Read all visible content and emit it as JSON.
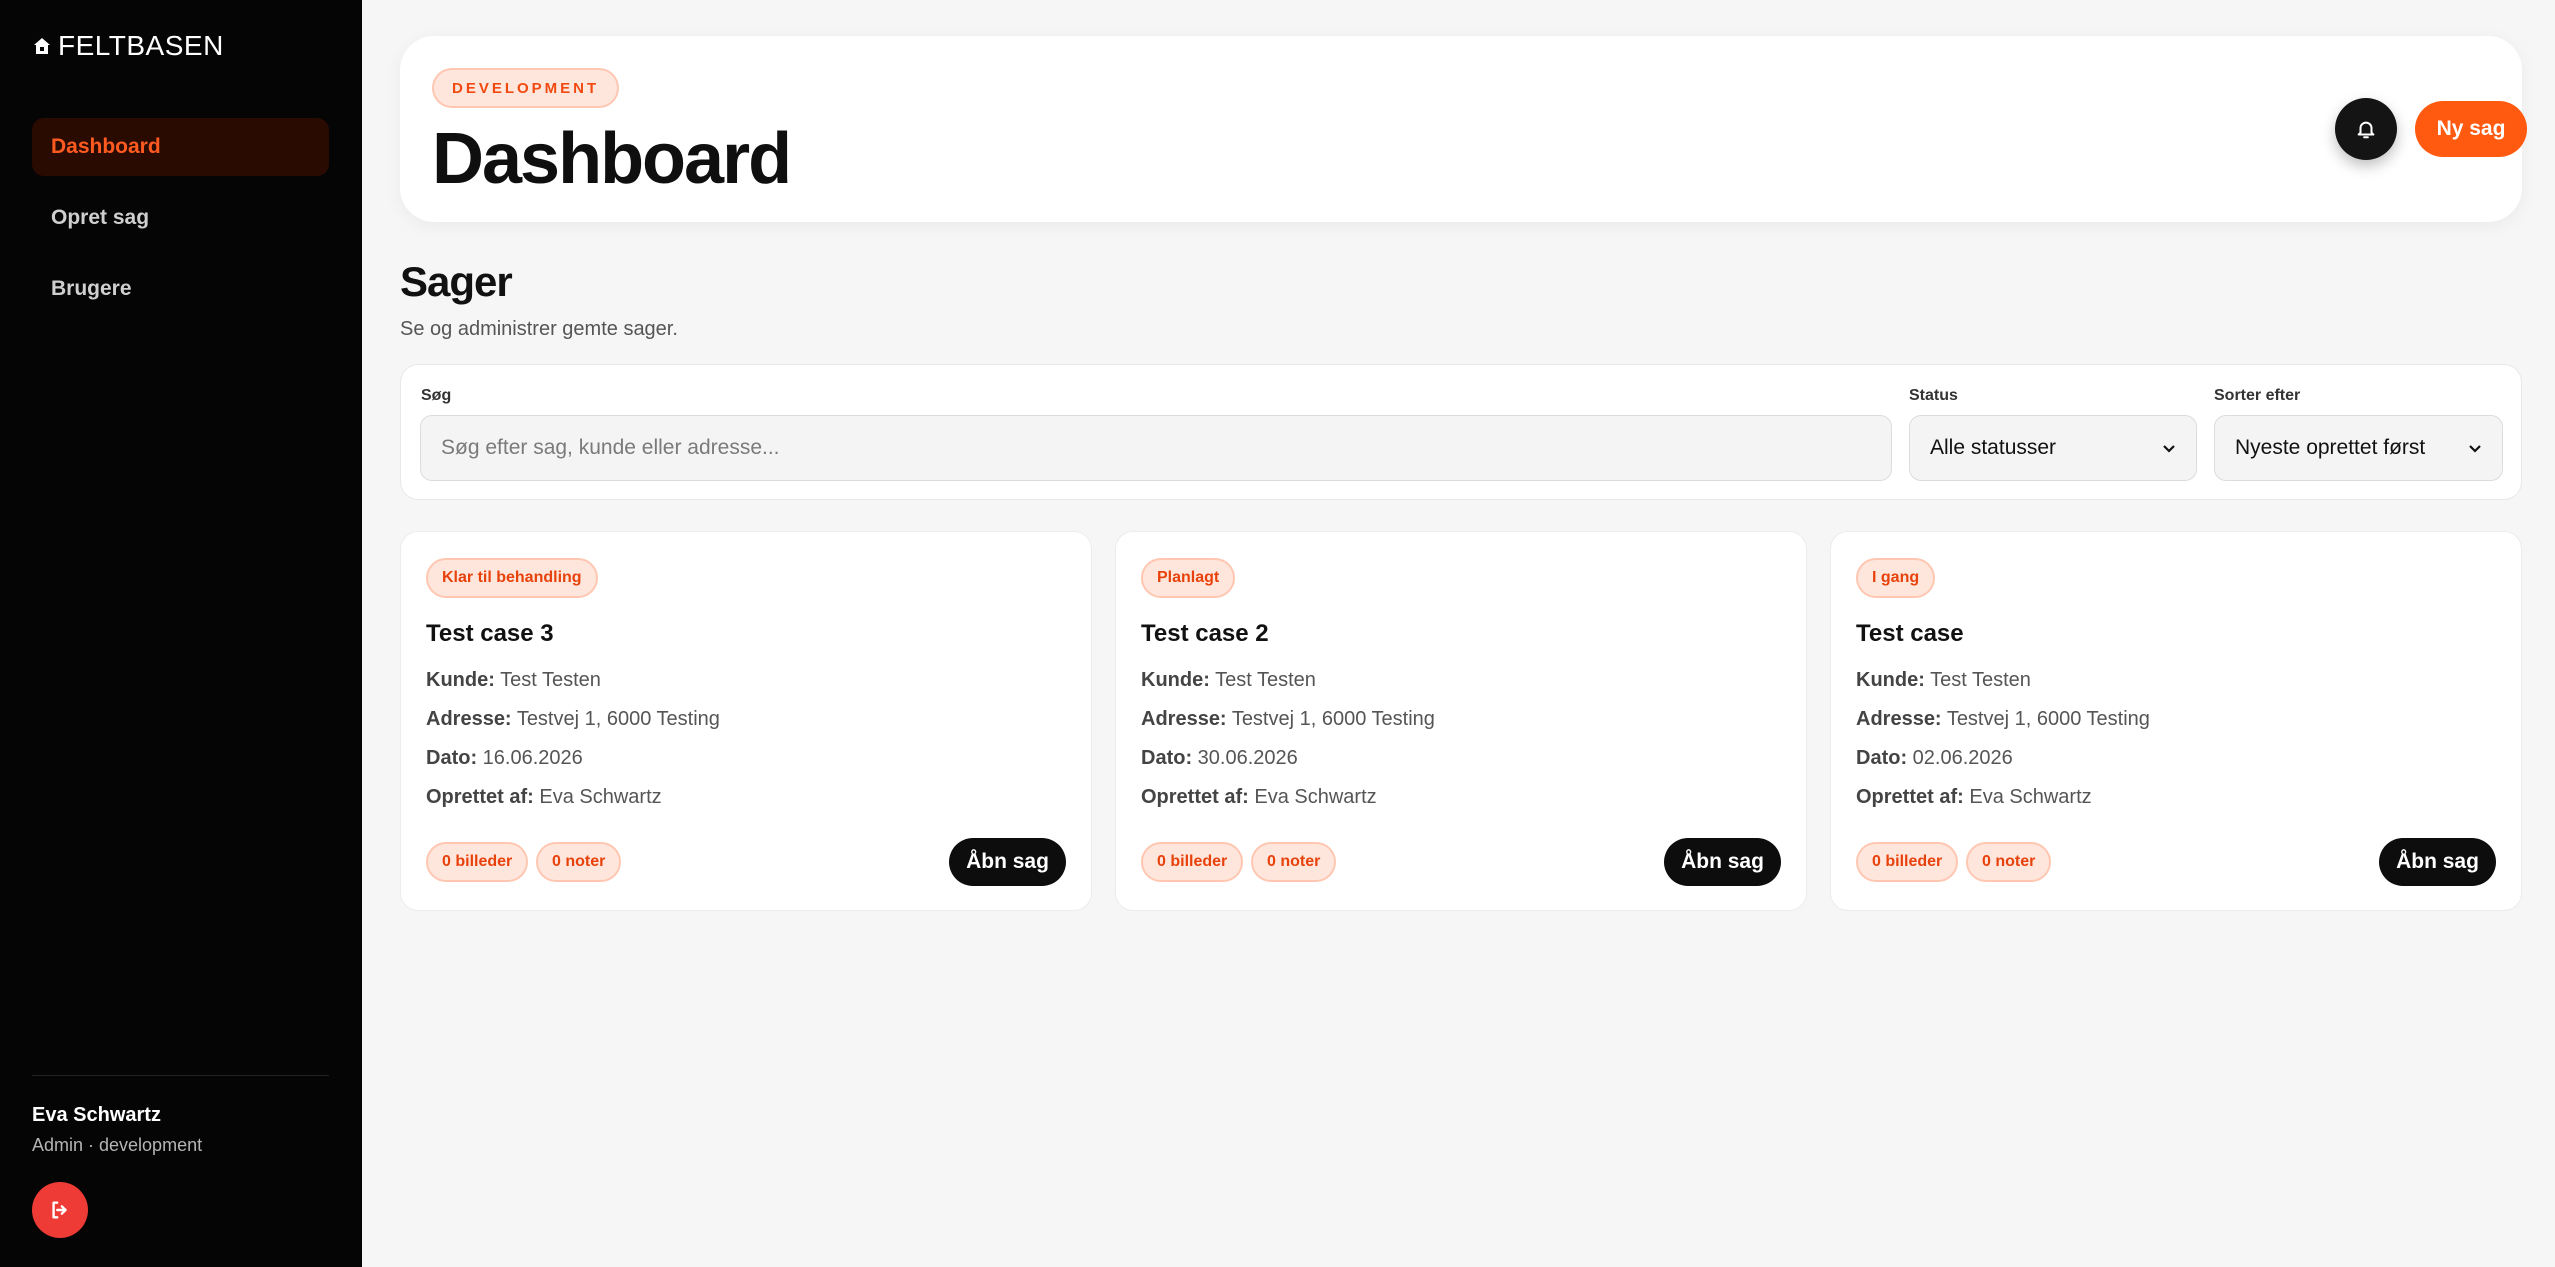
{
  "app": {
    "brand": "FELTBASEN"
  },
  "sidebar": {
    "items": [
      {
        "label": "Dashboard",
        "active": true
      },
      {
        "label": "Opret sag",
        "active": false
      },
      {
        "label": "Brugere",
        "active": false
      }
    ],
    "user": {
      "name": "Eva Schwartz",
      "role": "Admin · development"
    }
  },
  "header": {
    "env_badge": "DEVELOPMENT",
    "title": "Dashboard",
    "new_button": "Ny sag"
  },
  "section": {
    "title": "Sager",
    "subtitle": "Se og administrer gemte sager."
  },
  "filters": {
    "search_label": "Søg",
    "search_placeholder": "Søg efter sag, kunde eller adresse...",
    "status_label": "Status",
    "status_value": "Alle statusser",
    "sort_label": "Sorter efter",
    "sort_value": "Nyeste oprettet først"
  },
  "labels": {
    "customer": "Kunde:",
    "address": "Adresse:",
    "date": "Dato:",
    "created_by": "Oprettet af:",
    "open": "Åbn sag"
  },
  "cases": [
    {
      "status": "Klar til behandling",
      "title": "Test case 3",
      "customer": "Test Testen",
      "address": "Testvej 1, 6000 Testing",
      "date": "16.06.2026",
      "created_by": "Eva Schwartz",
      "images": "0 billeder",
      "notes": "0 noter"
    },
    {
      "status": "Planlagt",
      "title": "Test case 2",
      "customer": "Test Testen",
      "address": "Testvej 1, 6000 Testing",
      "date": "30.06.2026",
      "created_by": "Eva Schwartz",
      "images": "0 billeder",
      "notes": "0 noter"
    },
    {
      "status": "I gang",
      "title": "Test case",
      "customer": "Test Testen",
      "address": "Testvej 1, 6000 Testing",
      "date": "02.06.2026",
      "created_by": "Eva Schwartz",
      "images": "0 billeder",
      "notes": "0 noter"
    }
  ],
  "colors": {
    "accent": "#ff5a0f",
    "sidebar_bg": "#050505",
    "logout": "#ef3b36"
  },
  "icons": {
    "brand": "house-icon",
    "bell": "bell-icon",
    "logout": "logout-icon",
    "select": "chevron-down-icon"
  }
}
